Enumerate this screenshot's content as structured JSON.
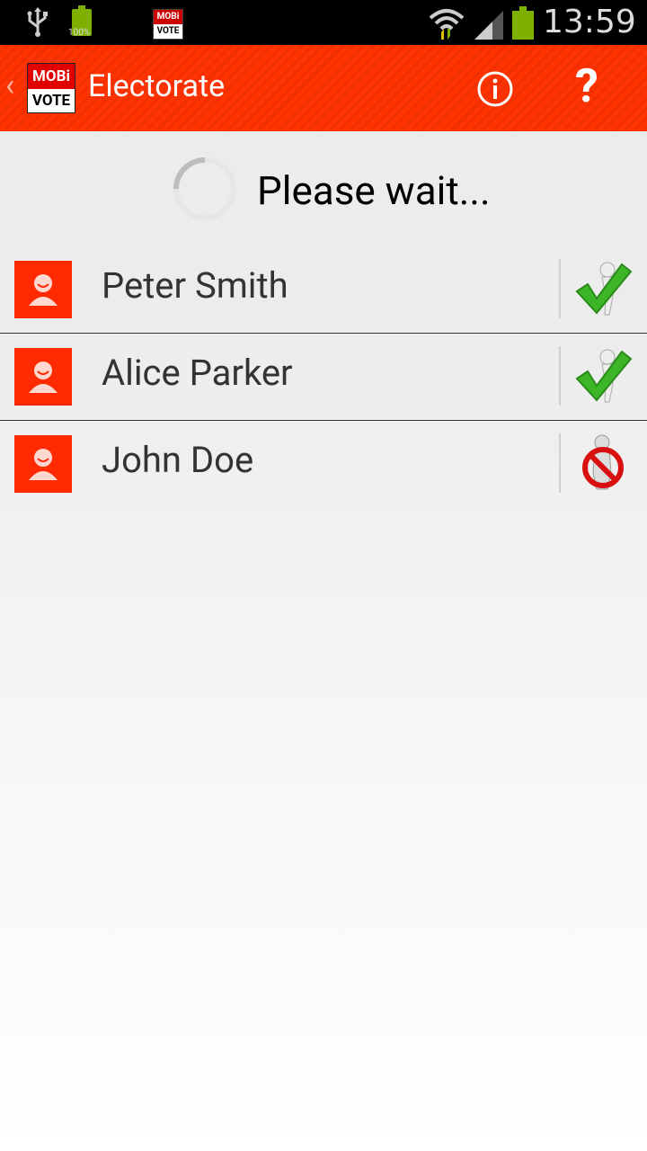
{
  "status_bar": {
    "time": "13:59",
    "battery_small_label": "100%",
    "notification_app_icon": {
      "top": "MOBi",
      "bottom": "VOTE"
    }
  },
  "action_bar": {
    "logo": {
      "top": "MOBi",
      "bottom": "VOTE"
    },
    "title": "Electorate",
    "icons": [
      "back-chevron-icon",
      "info-icon",
      "help-icon"
    ],
    "help_glyph": "?",
    "back_glyph": "‹"
  },
  "loading": {
    "text": "Please wait..."
  },
  "voters": [
    {
      "name": "Peter Smith",
      "status": "voted",
      "status_icon": "voted-check-icon"
    },
    {
      "name": "Alice Parker",
      "status": "voted",
      "status_icon": "voted-check-icon"
    },
    {
      "name": "John Doe",
      "status": "not-voted",
      "status_icon": "not-voted-icon"
    }
  ],
  "colors": {
    "accent": "#ff3300",
    "avatar": "#ff2a00",
    "check_green": "#3cb527",
    "no_red": "#d81010"
  }
}
